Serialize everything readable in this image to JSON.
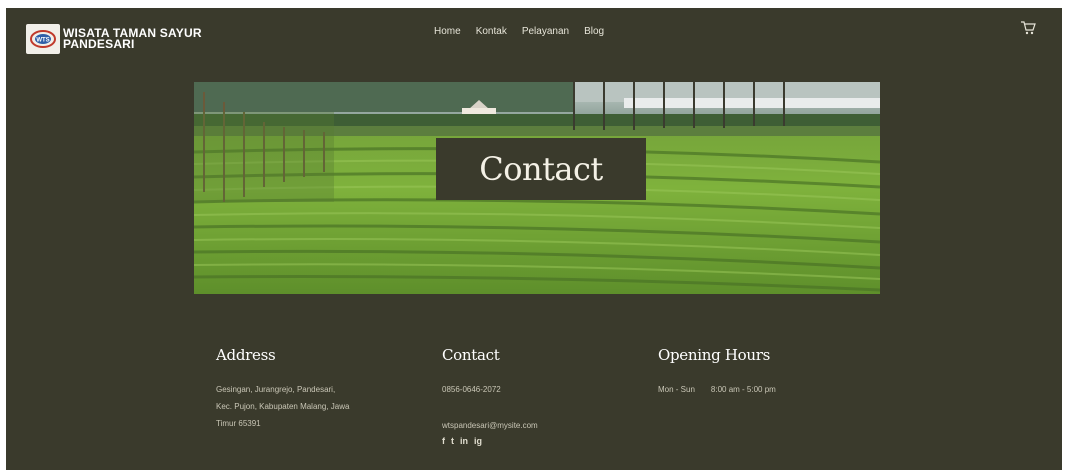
{
  "brand": {
    "name_line1": "WISATA TAMAN SAYUR",
    "name_line2": "PANDESARI",
    "logo_mark": "WTS"
  },
  "nav": {
    "items": [
      {
        "label": "Home"
      },
      {
        "label": "Kontak"
      },
      {
        "label": "Pelayanan"
      },
      {
        "label": "Blog"
      }
    ]
  },
  "icons": {
    "cart": "cart-icon",
    "facebook": "facebook-icon",
    "twitter": "twitter-icon",
    "linkedin": "linkedin-icon",
    "instagram": "instagram-icon"
  },
  "hero": {
    "title": "Contact"
  },
  "address": {
    "heading": "Address",
    "line1": "Gesingan, Jurangrejo, Pandesari,",
    "line2": "Kec. Pujon, Kabupaten Malang, Jawa",
    "line3": "Timur 65391"
  },
  "contact": {
    "heading": "Contact",
    "phone": "0856-0646-2072",
    "email": "wtspandesari@mysite.com",
    "socials": [
      "f",
      "t",
      "in",
      "ig"
    ]
  },
  "hours": {
    "heading": "Opening Hours",
    "days": "Mon - Sun",
    "time": "8:00 am - 5:00 pm"
  },
  "colors": {
    "background": "#3a3a2c",
    "text_light": "#ffffff",
    "text_muted": "#c9c6b6"
  }
}
